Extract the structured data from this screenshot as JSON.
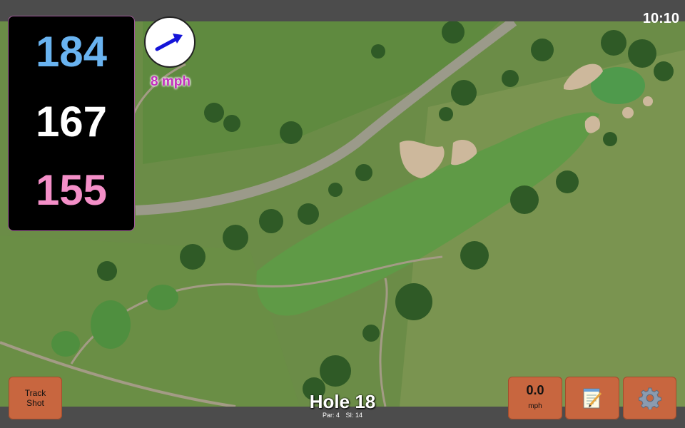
{
  "status_bar": {
    "time": "10:10"
  },
  "distances": {
    "back": "184",
    "middle": "167",
    "front": "155"
  },
  "distance_colors": {
    "back": "#69b3f0",
    "middle": "#ffffff",
    "front": "#f48fc8"
  },
  "wind": {
    "speed": "8 mph",
    "arrow_icon": "wind-arrow-icon",
    "arrow_color": "#1414d8"
  },
  "buttons": {
    "track_shot": {
      "line1": "Track",
      "line2": "Shot"
    },
    "speed": {
      "value": "0.0",
      "unit": "mph"
    },
    "notes_icon": "notepad-icon",
    "settings_icon": "gear-icon"
  },
  "hole": {
    "title": "Hole 18",
    "par": "Par: 4",
    "si": "SI: 14"
  },
  "colors": {
    "button": "#c8663f",
    "panel": "#000000",
    "wind_label": "#c32fbd",
    "bars": "#4c4c4c"
  }
}
